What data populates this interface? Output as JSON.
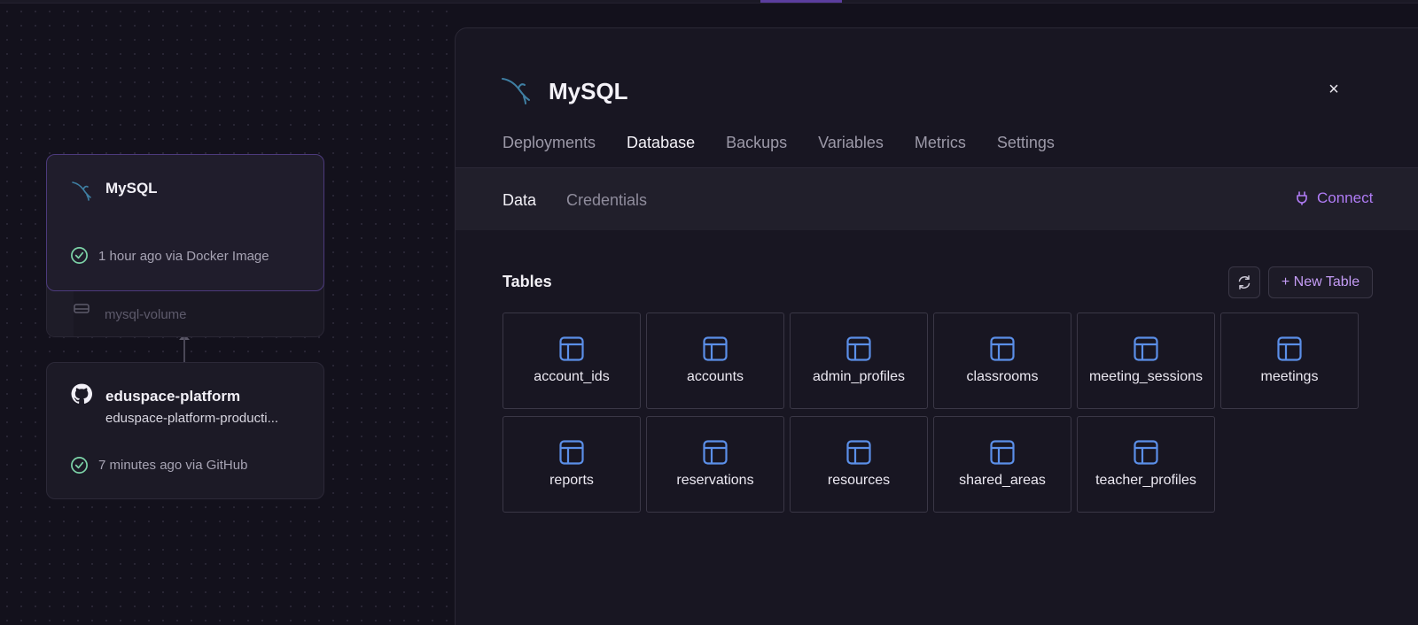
{
  "canvas": {
    "mysql_card": {
      "title": "MySQL",
      "status": "1 hour ago via Docker Image",
      "icon": "mysql-dolphin-icon",
      "volume": "mysql-volume"
    },
    "github_card": {
      "title": "eduspace-platform",
      "subtitle": "eduspace-platform-producti...",
      "status": "7 minutes ago via GitHub",
      "icon": "github-icon"
    }
  },
  "panel": {
    "title": "MySQL",
    "close": "×",
    "tabs": [
      {
        "label": "Deployments"
      },
      {
        "label": "Database"
      },
      {
        "label": "Backups"
      },
      {
        "label": "Variables"
      },
      {
        "label": "Metrics"
      },
      {
        "label": "Settings"
      }
    ],
    "active_tab": "Database",
    "subtabs": [
      {
        "label": "Data"
      },
      {
        "label": "Credentials"
      }
    ],
    "connect_label": "Connect",
    "tables_label": "Tables",
    "new_table_label": "+ New Table",
    "tables": [
      {
        "name": "account_ids"
      },
      {
        "name": "accounts"
      },
      {
        "name": "admin_profiles"
      },
      {
        "name": "classrooms"
      },
      {
        "name": "meeting_sessions"
      },
      {
        "name": "meetings"
      },
      {
        "name": "reports"
      },
      {
        "name": "reservations"
      },
      {
        "name": "resources"
      },
      {
        "name": "shared_areas"
      },
      {
        "name": "teacher_profiles"
      }
    ]
  },
  "colors": {
    "accent_purple": "#b07cf5",
    "table_icon_blue": "#5b8fe8",
    "success_green": "#7dd3a8",
    "background": "#13111c"
  }
}
